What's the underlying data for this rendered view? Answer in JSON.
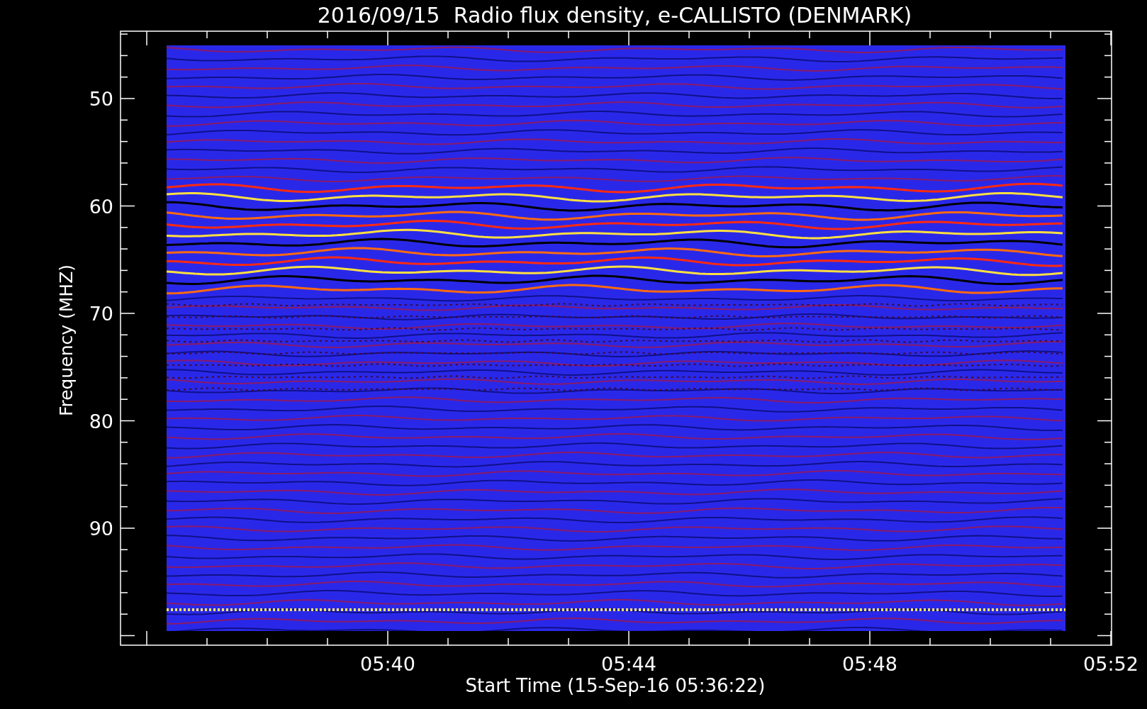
{
  "title": "2016/09/15  Radio flux density, e-CALLISTO (DENMARK)",
  "y_axis": {
    "label": "Frequency (MHZ)",
    "ticks": [
      {
        "label": "50"
      },
      {
        "label": "60"
      },
      {
        "label": "70"
      },
      {
        "label": "80"
      },
      {
        "label": "90"
      }
    ]
  },
  "x_axis": {
    "label": "Start Time (15-Sep-16 05:36:22)",
    "ticks": [
      {
        "label": "05:40"
      },
      {
        "label": "05:44"
      },
      {
        "label": "05:48"
      },
      {
        "label": "05:52"
      }
    ]
  }
}
